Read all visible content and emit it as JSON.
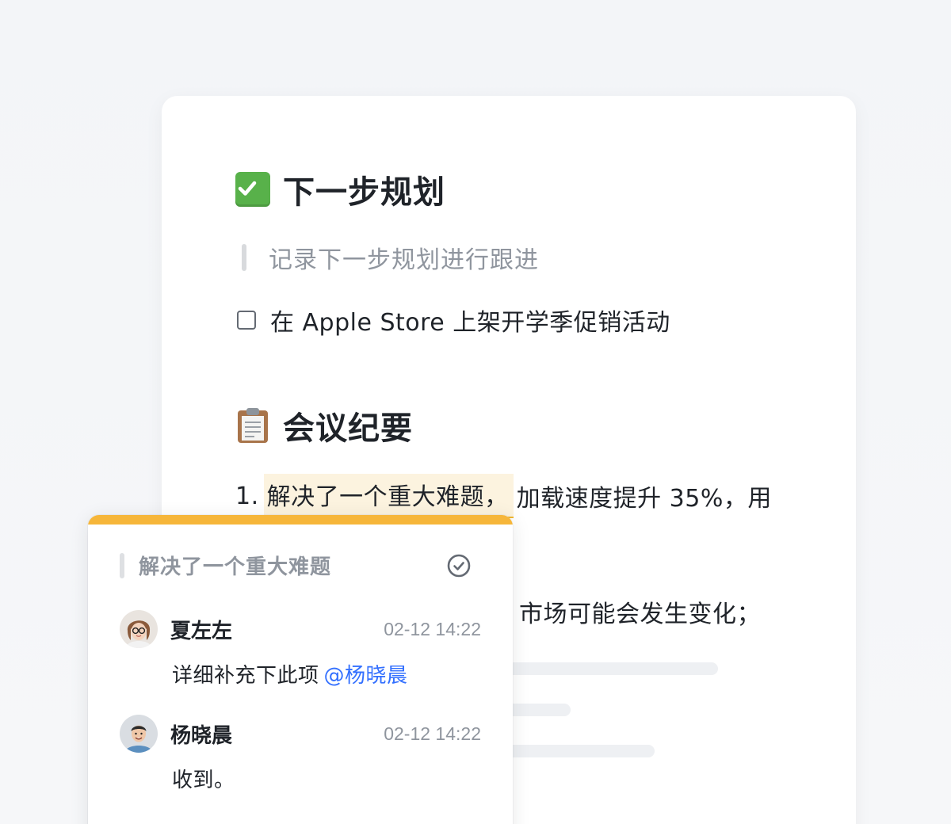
{
  "document": {
    "section_plan": {
      "emoji": "check-mark-button-emoji",
      "title": "下一步规划",
      "quote": "记录下一步规划进行跟进",
      "todo": {
        "text": "在 Apple Store 上架开学季促销活动",
        "checked": false
      }
    },
    "section_minutes": {
      "emoji": "clipboard-emoji",
      "title": "会议纪要",
      "item_1": {
        "number": "1.",
        "highlighted": "解决了一个重大难题，",
        "rest": "加载速度提升 35%，用"
      },
      "line_2": "市场可能会发生变化；"
    }
  },
  "comment_panel": {
    "accent_color": "#f6b63a",
    "quoted_text": "解决了一个重大难题",
    "resolve_icon": "check-circle-icon",
    "comments": [
      {
        "author": "夏左左",
        "time": "02-12 14:22",
        "text": "详细补充下此项",
        "mention": "@杨晓晨"
      },
      {
        "author": "杨晓晨",
        "time": "02-12 14:22",
        "text": "收到。"
      }
    ]
  }
}
